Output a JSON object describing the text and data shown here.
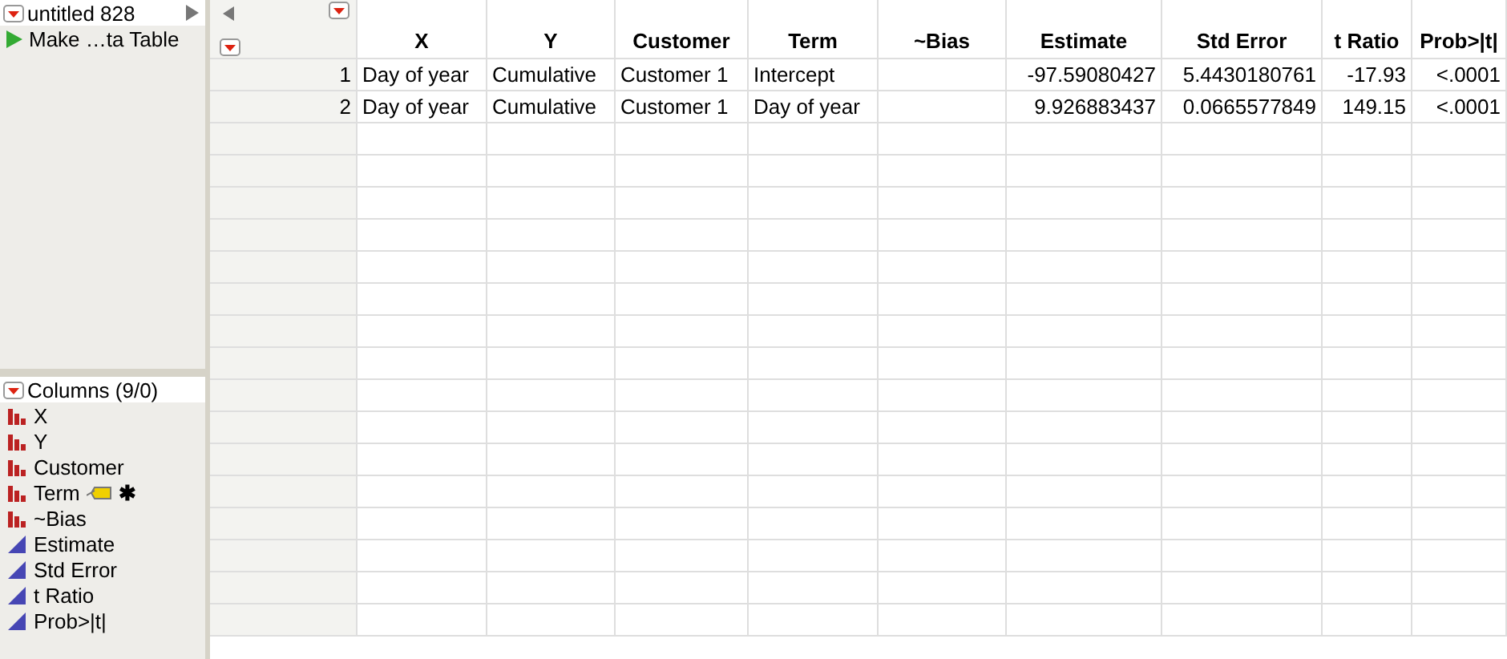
{
  "table_panel": {
    "title": "untitled 828",
    "script": "Make …ta Table"
  },
  "columns_panel": {
    "title": "Columns (9/0)",
    "items": [
      {
        "name": "X",
        "kind": "nominal",
        "tagged": false
      },
      {
        "name": "Y",
        "kind": "nominal",
        "tagged": false
      },
      {
        "name": "Customer",
        "kind": "nominal",
        "tagged": false
      },
      {
        "name": "Term",
        "kind": "nominal",
        "tagged": true,
        "suffix": "✱"
      },
      {
        "name": "~Bias",
        "kind": "nominal",
        "tagged": false
      },
      {
        "name": "Estimate",
        "kind": "continuous",
        "tagged": false
      },
      {
        "name": "Std Error",
        "kind": "continuous",
        "tagged": false
      },
      {
        "name": "t Ratio",
        "kind": "continuous",
        "tagged": false
      },
      {
        "name": "Prob>|t|",
        "kind": "continuous",
        "tagged": false
      }
    ]
  },
  "table": {
    "columns": [
      {
        "label": "X",
        "kind": "nominal"
      },
      {
        "label": "Y",
        "kind": "nominal"
      },
      {
        "label": "Customer",
        "kind": "nominal"
      },
      {
        "label": "Term",
        "kind": "nominal"
      },
      {
        "label": "~Bias"
      },
      {
        "label": "Estimate",
        "kind": "continuous"
      },
      {
        "label": "Std Error",
        "kind": "continuous"
      },
      {
        "label": "t Ratio",
        "kind": "continuous"
      },
      {
        "label": "Prob>|t|",
        "kind": "continuous"
      }
    ],
    "rows": [
      {
        "number": "1",
        "cells": [
          "Day of year",
          "Cumulative",
          "Customer 1",
          "Intercept",
          null,
          "-97.59080427",
          "5.4430180761",
          "-17.93",
          "<.0001"
        ]
      },
      {
        "number": "2",
        "cells": [
          "Day of year",
          "Cumulative",
          "Customer 1",
          "Day of year",
          null,
          "9.926883437",
          "0.0665577849",
          "149.15",
          "<.0001"
        ]
      }
    ]
  }
}
